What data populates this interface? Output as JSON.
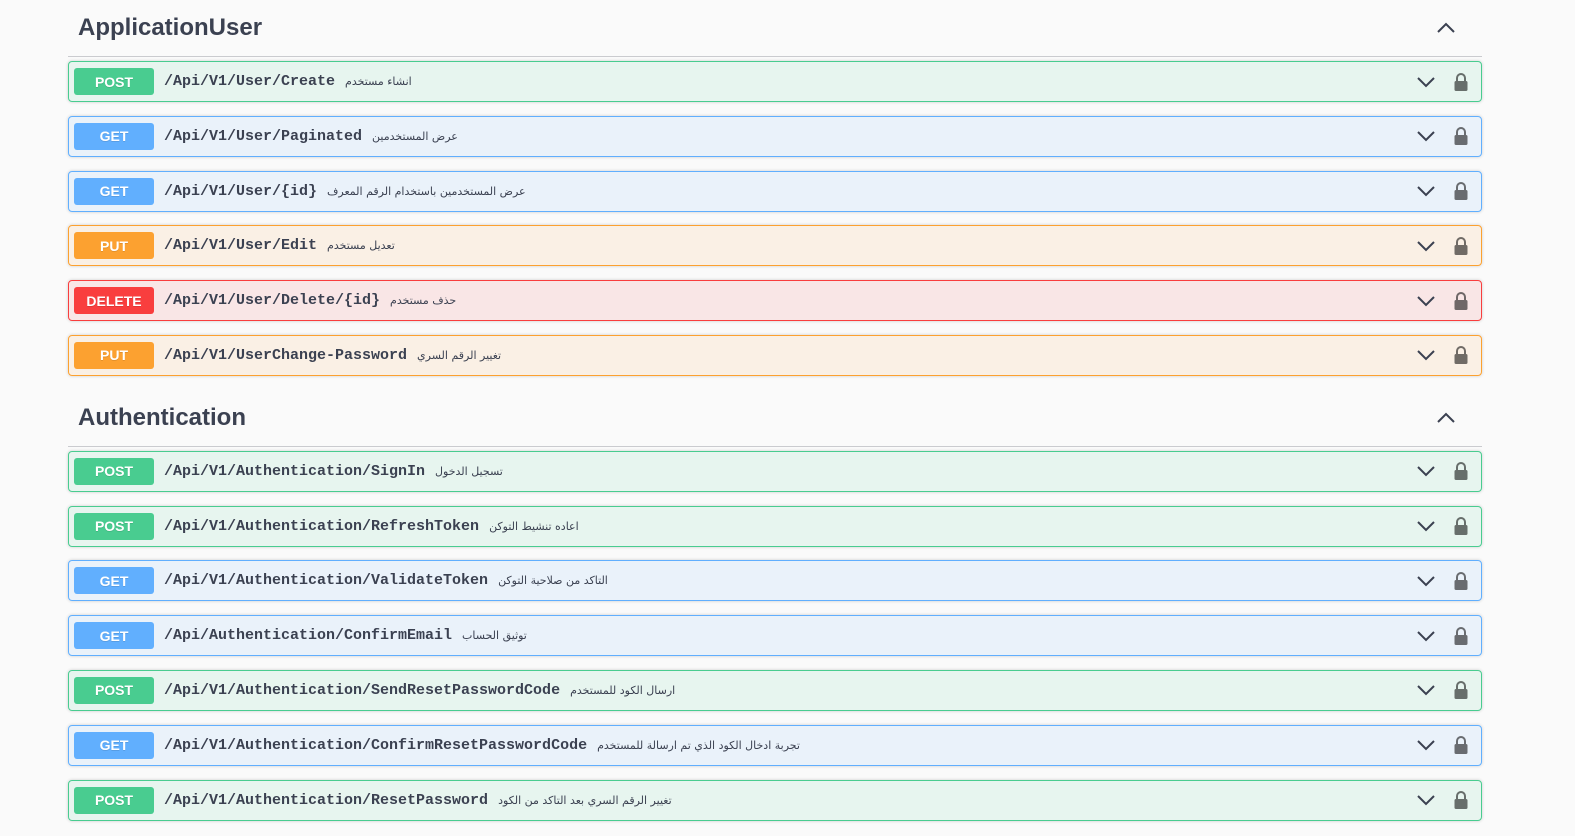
{
  "colors": {
    "post": "#49cc90",
    "get": "#61affe",
    "put": "#fca130",
    "delete": "#f93e3e",
    "text": "#3b4151"
  },
  "sections": [
    {
      "name": "ApplicationUser",
      "collapse_icon": "chevron-up-icon",
      "operations": [
        {
          "method": "POST",
          "path": "/Api/V1/User/Create",
          "summary": "انشاء مستخدم"
        },
        {
          "method": "GET",
          "path": "/Api/V1/User/Paginated",
          "summary": "عرض المستخدمين"
        },
        {
          "method": "GET",
          "path": "/Api/V1/User/{id}",
          "summary": "عرض المستخدمين باستخدام الرقم المعرف"
        },
        {
          "method": "PUT",
          "path": "/Api/V1/User/Edit",
          "summary": "تعديل مستخدم"
        },
        {
          "method": "DELETE",
          "path": "/Api/V1/User/Delete/{id}",
          "summary": "حذف مستخدم"
        },
        {
          "method": "PUT",
          "path": "/Api/V1/UserChange-Password",
          "summary": "تغيير الرقم السري"
        }
      ]
    },
    {
      "name": "Authentication",
      "collapse_icon": "chevron-up-icon",
      "operations": [
        {
          "method": "POST",
          "path": "/Api/V1/Authentication/SignIn",
          "summary": "تسجيل الدخول"
        },
        {
          "method": "POST",
          "path": "/Api/V1/Authentication/RefreshToken",
          "summary": "اعاده تنشيط التوكن"
        },
        {
          "method": "GET",
          "path": "/Api/V1/Authentication/ValidateToken",
          "summary": "التاكد من صلاحية التوكن"
        },
        {
          "method": "GET",
          "path": "/Api/Authentication/ConfirmEmail",
          "summary": "توثيق الحساب"
        },
        {
          "method": "POST",
          "path": "/Api/V1/Authentication/SendResetPasswordCode",
          "summary": "ارسال الكود للمستخدم"
        },
        {
          "method": "GET",
          "path": "/Api/V1/Authentication/ConfirmResetPasswordCode",
          "summary": "تجربة ادخال الكود الذي تم ارسالة للمستخدم"
        },
        {
          "method": "POST",
          "path": "/Api/V1/Authentication/ResetPassword",
          "summary": "تغيير الرقم السري بعد التاكد من الكود"
        }
      ]
    }
  ]
}
